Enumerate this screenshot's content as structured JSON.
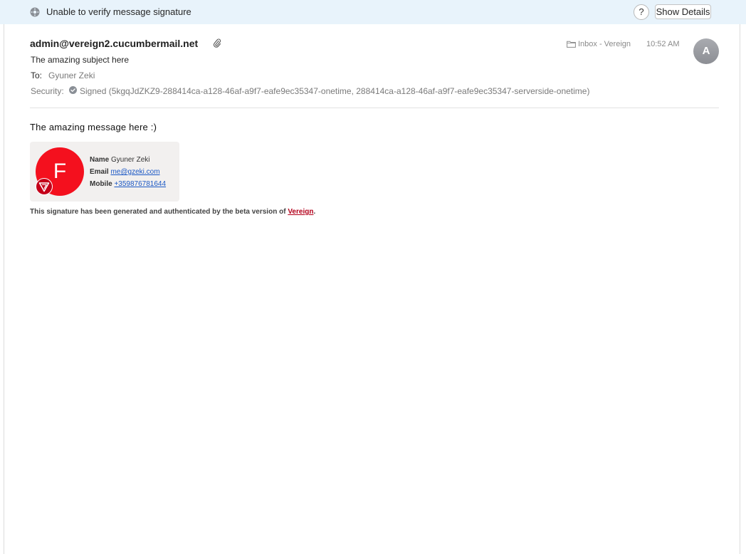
{
  "banner": {
    "text": "Unable to verify message signature",
    "help_label": "?",
    "details_label": "Show Details"
  },
  "message": {
    "from": "admin@vereign2.cucumbermail.net",
    "subject": "The amazing subject here",
    "to_label": "To:",
    "to_value": "Gyuner Zeki",
    "security_label": "Security:",
    "security_value": "Signed (5kgqJdZKZ9-288414ca-a128-46af-a9f7-eafe9ec35347-onetime, 288414ca-a128-46af-a9f7-eafe9ec35347-serverside-onetime)",
    "folder": "Inbox - Vereign",
    "time": "10:52 AM",
    "avatar_initial": "A",
    "body": "The amazing message here :)"
  },
  "signature": {
    "logo_letter": "F",
    "name_label": "Name",
    "name_value": "Gyuner Zeki",
    "email_label": "Email",
    "email_value": "me@gzeki.com",
    "mobile_label": "Mobile",
    "mobile_value": "+359876781644",
    "note_prefix": "This signature has been generated and authenticated by the beta version of",
    "note_link": "Vereign",
    "note_suffix": "."
  },
  "colors": {
    "banner_bg": "#e8f3fb",
    "logo_red": "#f4101e",
    "link_blue": "#1a57c4",
    "vereign_red": "#b3001b"
  },
  "icons": [
    "gear-icon",
    "paperclip-icon",
    "folder-icon",
    "shield-check-icon",
    "vereign-badge-icon"
  ]
}
